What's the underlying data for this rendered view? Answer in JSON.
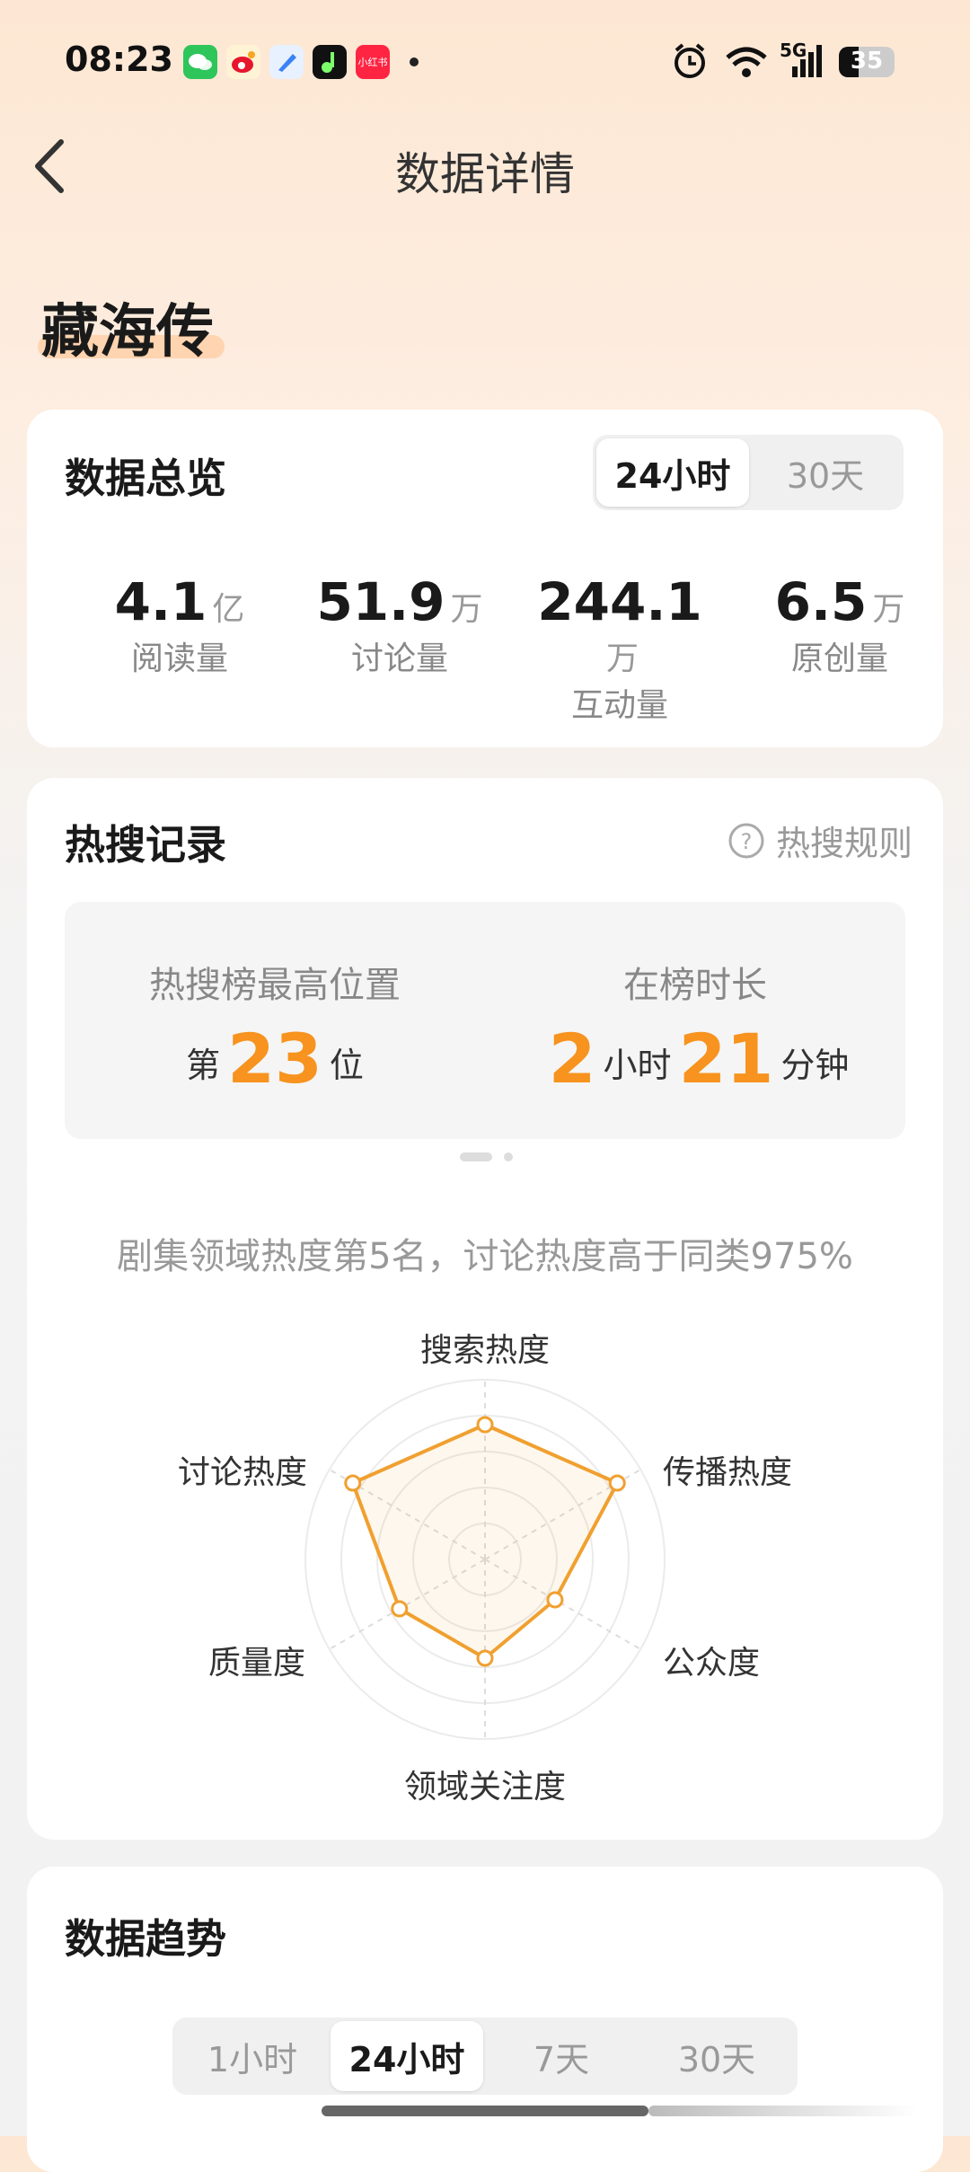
{
  "status_bar": {
    "time": "08:23",
    "app_icons": [
      "wechat-icon",
      "weibo-icon",
      "browser-icon",
      "music-icon",
      "xiaohongshu-icon"
    ],
    "xiaohongshu_label": "小红书",
    "network": "5G",
    "battery": "35"
  },
  "nav": {
    "title": "数据详情"
  },
  "topic": "藏海传",
  "overview": {
    "title": "数据总览",
    "tabs": [
      "24小时",
      "30天"
    ],
    "active_tab": "24小时",
    "stats": [
      {
        "value": "4.1",
        "unit": "亿",
        "label": "阅读量"
      },
      {
        "value": "51.9",
        "unit": "万",
        "label": "讨论量"
      },
      {
        "value": "244.1",
        "unit": "万",
        "label": "互动量"
      },
      {
        "value": "6.5",
        "unit": "万",
        "label": "原创量"
      }
    ]
  },
  "hot_search": {
    "title": "热搜记录",
    "rules_link": "热搜规则",
    "highest_label": "热搜榜最高位置",
    "highest_prefix": "第",
    "highest_value": "23",
    "highest_suffix": "位",
    "duration_label": "在榜时长",
    "duration_hours": "2",
    "hours_unit": "小时",
    "duration_minutes": "21",
    "minutes_unit": "分钟",
    "summary": "剧集领域热度第5名，讨论热度高于同类975%"
  },
  "radar": {
    "axes": [
      "搜索热度",
      "传播热度",
      "公众度",
      "领域关注度",
      "质量度",
      "讨论热度"
    ],
    "values": [
      0.75,
      0.85,
      0.45,
      0.55,
      0.55,
      0.85
    ],
    "color": "#f0a030"
  },
  "trend": {
    "title": "数据趋势",
    "tabs": [
      "1小时",
      "24小时",
      "7天",
      "30天"
    ],
    "active_tab": "24小时"
  },
  "colors": {
    "accent": "#f7931e",
    "background_top": "#fde7d3"
  }
}
